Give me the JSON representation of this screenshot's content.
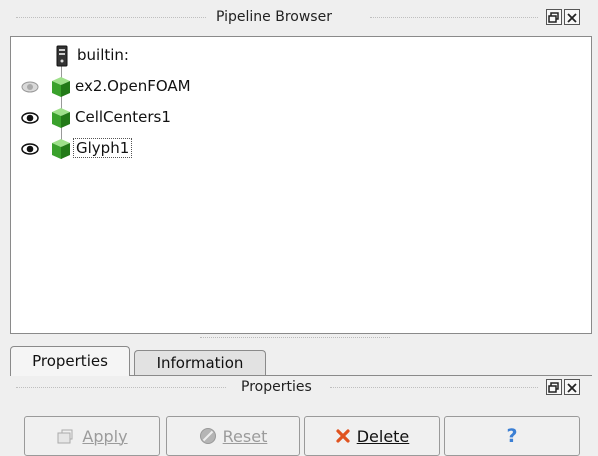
{
  "pipeline_browser": {
    "title": "Pipeline Browser",
    "items": [
      {
        "label": "builtin:",
        "icon": "server-icon",
        "visible": null
      },
      {
        "label": "ex2.OpenFOAM",
        "icon": "cube-icon",
        "visible": false
      },
      {
        "label": "CellCenters1",
        "icon": "cube-icon",
        "visible": true
      },
      {
        "label": "Glyph1",
        "icon": "cube-icon",
        "visible": true,
        "selected": true
      }
    ]
  },
  "tabs": [
    {
      "label": "Properties",
      "active": true
    },
    {
      "label": "Information",
      "active": false
    }
  ],
  "properties_panel": {
    "title": "Properties",
    "buttons": {
      "apply": {
        "label": "Apply",
        "icon": "apply-icon",
        "enabled": false
      },
      "reset": {
        "label": "Reset",
        "icon": "reset-icon",
        "enabled": false
      },
      "delete": {
        "label": "Delete",
        "icon": "delete-x-icon",
        "enabled": true
      },
      "help": {
        "label": "?",
        "icon": "help-icon",
        "enabled": true
      }
    }
  }
}
